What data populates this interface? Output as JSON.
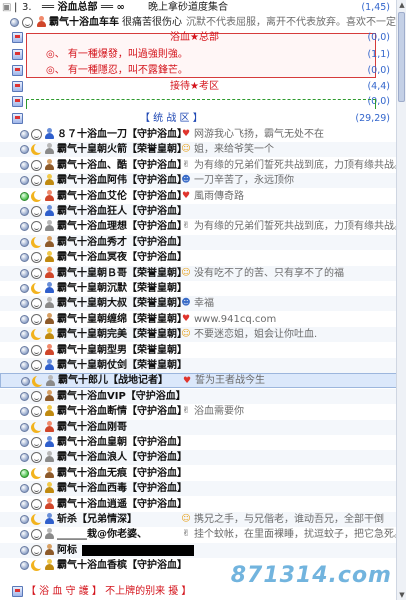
{
  "header": {
    "index": "3.",
    "sep": "|",
    "server_name": "══ 浴血总部 ══ ∞",
    "subtitle": "晚上拿砂道度集合",
    "count": "(1,45)"
  },
  "admin_line": {
    "name": "霸气十浴血车车",
    "status": "很痛苦很伤心",
    "message": "沉默不代表屈服，离开不代表放弃。喜欢不一定"
  },
  "channels": [
    {
      "name": "浴血★总部",
      "count": "(0,0)"
    },
    {
      "name": "◎、 有一種爆發，叫過強則強。",
      "count": "(1,1)"
    },
    {
      "name": "◎、 有一種隱忍，叫不露鋒芒。",
      "count": "(0,0)"
    },
    {
      "name": "接待★考区",
      "count": "(4,4)"
    },
    {
      "name": "",
      "count": "(0,0)"
    },
    {
      "name": "【 统 战 区 】",
      "count": "(29,29)"
    }
  ],
  "users": [
    {
      "name": "８７十浴血一刀【守护浴血】",
      "message": "网游我心飞扬，霸气无处不在"
    },
    {
      "name": "霸气十皇朝火箭【荣誉皇朝】",
      "message": "姐，来给爷笑一个"
    },
    {
      "name": "霸气十浴血、酷【守护浴血】",
      "message": "为有缘的兄弟们誓死共战到底，力顶有缘共战。"
    },
    {
      "name": "霸气十浴血阿伟【守护浴血】",
      "message": "一刀辛苦了，永远顶你"
    },
    {
      "name": "霸气十浴血艾伦【守护浴血】",
      "message": "風雨傳奇路 "
    },
    {
      "name": "霸气十浴血狂人【守护浴血】",
      "message": ""
    },
    {
      "name": "霸气十浴血理想【守护浴血】",
      "message": "为有缘的兄弟们誓死共战到底，力顶有缘共战。"
    },
    {
      "name": "霸气十浴血秀才【守护浴血】",
      "message": ""
    },
    {
      "name": "霸气十浴血冥夜【守护浴血】",
      "message": ""
    },
    {
      "name": "霸气十皇朝Ｂ哥【荣誉皇朝】",
      "message": "没有吃不了的苦、只有享不了的福"
    },
    {
      "name": "霸气十皇朝沉默【荣誉皇朝】",
      "message": ""
    },
    {
      "name": "霸气十皇朝大叔【荣誉皇朝】",
      "message": "幸福"
    },
    {
      "name": "霸气十皇朝缠绵【荣誉皇朝】",
      "message": "www.941cq.com"
    },
    {
      "name": "霸气十皇朝完美【荣誉皇朝】",
      "message": "不要迷恋姐，姐会让你吐血."
    },
    {
      "name": "霸气十皇朝型男【荣誉皇朝】",
      "message": ""
    },
    {
      "name": "霸气十皇朝仗剑【荣誉皇朝】",
      "message": ""
    },
    {
      "name": "霸气十郎儿【战地记者】",
      "message": "誓为王者战今生"
    },
    {
      "name": "霸气十浴血VIP【守护浴血】",
      "message": ""
    },
    {
      "name": "霸气十浴血断情【守护浴血】",
      "message": "浴血需要你"
    },
    {
      "name": "霸气十浴血刚哥",
      "message": ""
    },
    {
      "name": "霸气十浴血皇朝【守护浴血】",
      "message": ""
    },
    {
      "name": "霸气十浴血浪人【守护浴血】",
      "message": ""
    },
    {
      "name": "霸气十浴血无痕【守护浴血】",
      "message": ""
    },
    {
      "name": "霸气十浴血西毒【守护浴血】",
      "message": ""
    },
    {
      "name": "霸气十浴血逍遥【守护浴血】",
      "message": ""
    },
    {
      "name": "斩杀【兄弟情深】",
      "message": "携兄之手，与兄偕老，谁动吾兄，全部干倒"
    },
    {
      "name": "______栽@你老婆、",
      "message": "挂个蚊帐，在里面裸睡，扰逗蚊子，把它急死。"
    },
    {
      "name": "阿标",
      "message": ""
    },
    {
      "name": "霸气十浴血香槟【守护浴血】",
      "message": ""
    }
  ],
  "footer_channel": {
    "name": "【 浴 血 守 護 】 不上牌的别来 擾 】"
  },
  "watermark": "871314.com",
  "colors": {
    "red": "#d4141c",
    "blue": "#1f48b4",
    "count": "#3366cc"
  }
}
